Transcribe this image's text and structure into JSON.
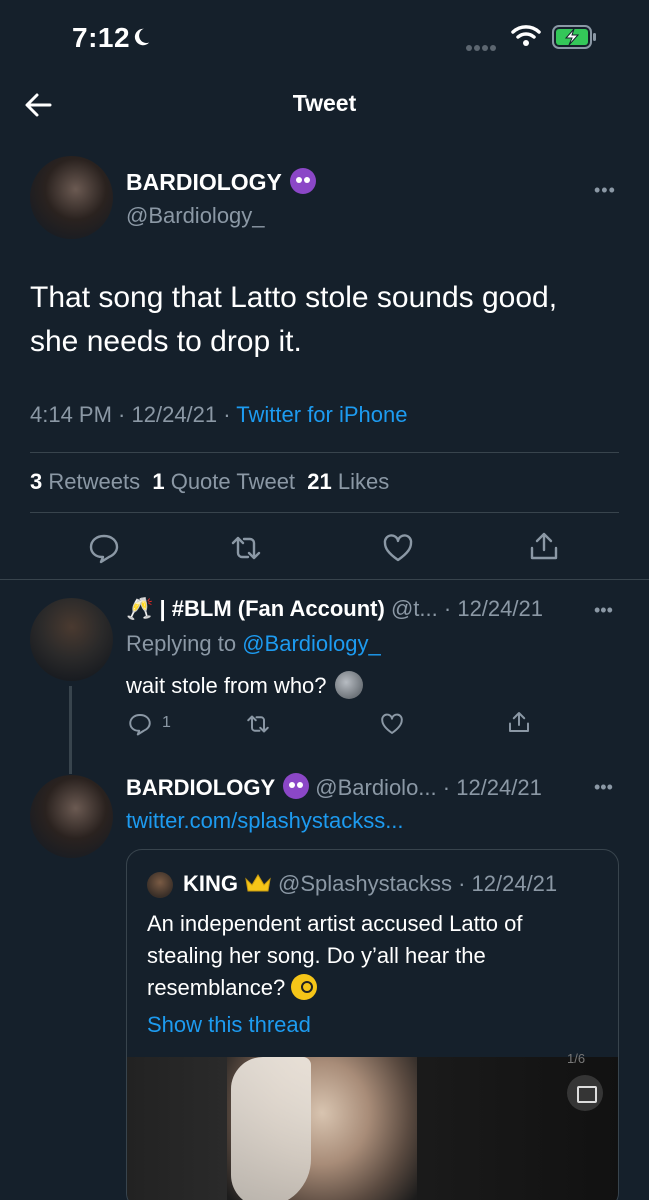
{
  "status_bar": {
    "time": "7:12"
  },
  "header": {
    "title": "Tweet"
  },
  "main_tweet": {
    "display_name": "BARDIOLOGY",
    "handle": "@Bardiology_",
    "text": "That song that Latto stole sounds good, she needs to drop it.",
    "time": "4:14 PM",
    "date": "12/24/21",
    "source": "Twitter for iPhone",
    "stats": {
      "retweets_count": "3",
      "retweets_label": "Retweets",
      "quotes_count": "1",
      "quotes_label": "Quote Tweet",
      "likes_count": "21",
      "likes_label": "Likes"
    },
    "more": "•••"
  },
  "replies": [
    {
      "display_name": "🥂 | #BLM (Fan Account)",
      "handle": "@t...",
      "date": "12/24/21",
      "replying_prefix": "Replying to",
      "replying_handle": "@Bardiology_",
      "text": "wait stole from who?",
      "reply_count": "1",
      "more": "•••"
    },
    {
      "display_name": "BARDIOLOGY",
      "handle": "@Bardiolo...",
      "date": "12/24/21",
      "link": "twitter.com/splashystackss...",
      "more": "•••",
      "quote": {
        "display_name": "KING",
        "handle": "@Splashystackss",
        "date": "12/24/21",
        "text": "An independent artist accused Latto of stealing her song. Do y’all hear the resemblance?",
        "show_thread": "Show this thread",
        "media_counter": "1/6"
      }
    }
  ],
  "colors": {
    "background": "#15202b",
    "accent": "#1d9bf0",
    "muted": "#8b98a5",
    "divider": "#38444d"
  },
  "icons": [
    "moon-icon",
    "signal-icon",
    "wifi-icon",
    "battery-charging-icon",
    "back-arrow-icon",
    "reply-icon",
    "retweet-icon",
    "like-icon",
    "share-icon",
    "devil-emoji-icon",
    "crown-emoji-icon",
    "monocle-emoji-icon",
    "new-moon-emoji-icon",
    "closed-captions-icon"
  ]
}
